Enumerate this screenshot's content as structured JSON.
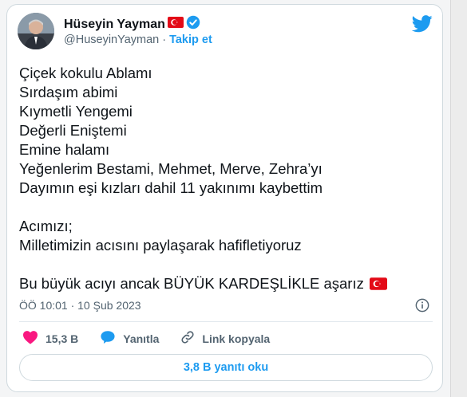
{
  "author": {
    "name": "Hüseyin Yayman",
    "handle": "@HuseyinYayman",
    "separator": "·",
    "follow_label": "Takip et"
  },
  "tweet": {
    "lines": [
      "Çiçek kokulu Ablamı",
      "Sırdaşım abimi",
      "Kıymetli Yengemi",
      "Değerli Eniştemi",
      "Emine halamı",
      "Yeğenlerim Bestami, Mehmet, Merve, Zehra’yı",
      "Dayımın eşi kızları dahil 11 yakınımı kaybettim",
      "",
      "Acımızı;",
      "Milletimizin acısını paylaşarak hafifletiyoruz",
      "",
      "Bu büyük acıyı ancak BÜYÜK KARDEŞLİKLE aşarız"
    ],
    "timestamp": "ÖÖ 10:01 · 10 Şub 2023"
  },
  "actions": {
    "likes": "15,3 B",
    "reply_label": "Yanıtla",
    "copy_link_label": "Link kopyala"
  },
  "replies_button": "3,8 B yanıtı oku",
  "colors": {
    "accent": "#1d9bf0",
    "like": "#f91880",
    "text": "#0f1419",
    "secondary": "#536471",
    "flag": "#e30a17"
  }
}
